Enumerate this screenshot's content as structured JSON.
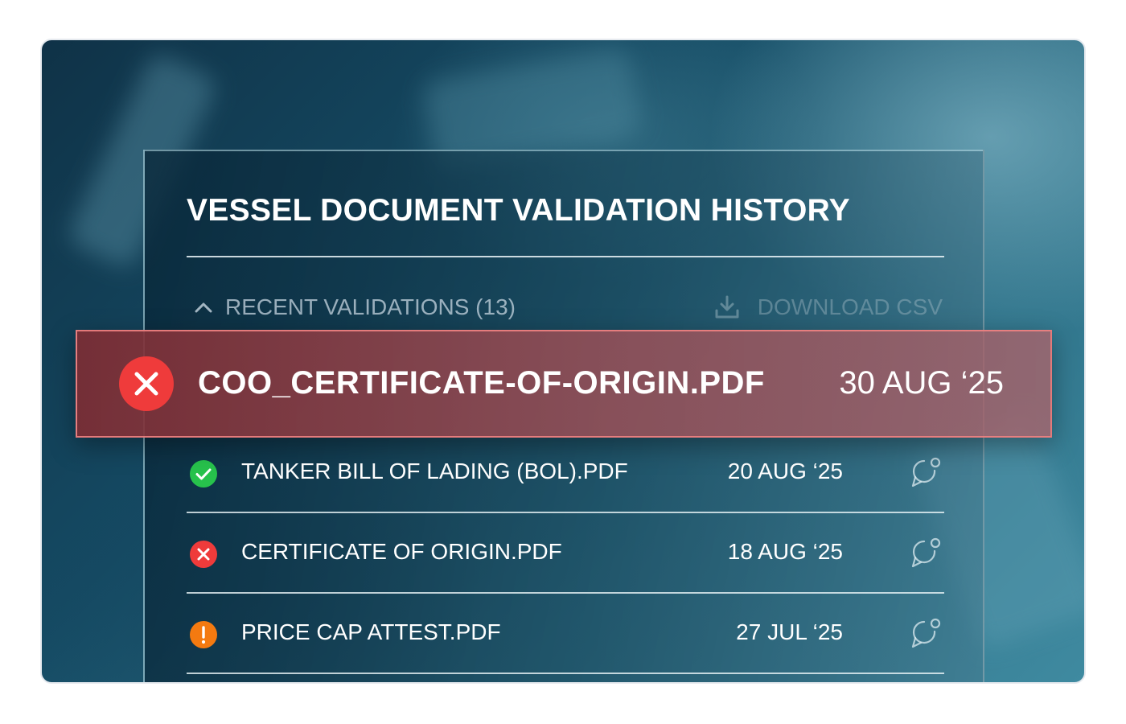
{
  "panel": {
    "title": "VESSEL DOCUMENT VALIDATION HISTORY",
    "section_label": "RECENT VALIDATIONS (13)",
    "download_label": "DOWNLOAD CSV"
  },
  "highlighted": {
    "file_name": "COO_CERTIFICATE-OF-ORIGIN.PDF",
    "date": "30 AUG ‘25",
    "status": "failed",
    "icon": "x-circle-icon"
  },
  "validations": [
    {
      "file_name": "TANKER BILL OF LADING (BOL).PDF",
      "date": "20 AUG ‘25",
      "status": "passed",
      "icon": "check-circle-icon"
    },
    {
      "file_name": "CERTIFICATE OF ORIGIN.PDF",
      "date": "18 AUG ‘25",
      "status": "failed",
      "icon": "x-circle-icon"
    },
    {
      "file_name": "PRICE CAP ATTEST.PDF",
      "date": "27 JUL ‘25",
      "status": "warning",
      "icon": "exclamation-circle-icon"
    }
  ],
  "colors": {
    "passed": "#27c24c",
    "failed": "#ef3b3b",
    "warning": "#f47a10",
    "highlight_bg": "#7d2d34"
  }
}
